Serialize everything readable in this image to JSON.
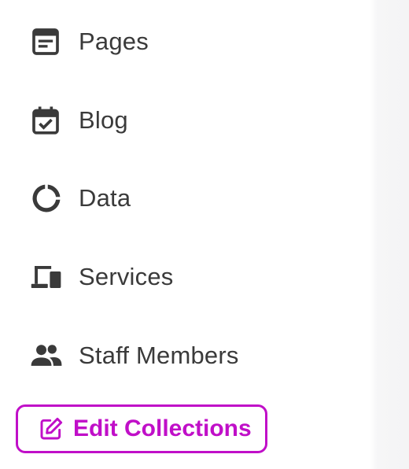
{
  "nav": {
    "items": [
      {
        "label": "Pages",
        "icon": "pages-icon"
      },
      {
        "label": "Blog",
        "icon": "calendar-check-icon"
      },
      {
        "label": "Data",
        "icon": "donut-chart-icon"
      },
      {
        "label": "Services",
        "icon": "devices-icon"
      },
      {
        "label": "Staff Members",
        "icon": "people-icon"
      }
    ]
  },
  "edit_button": {
    "label": "Edit Collections",
    "icon": "edit-icon",
    "color": "#c00fc8"
  },
  "colors": {
    "text": "#3a3a3a",
    "accent": "#c00fc8"
  }
}
